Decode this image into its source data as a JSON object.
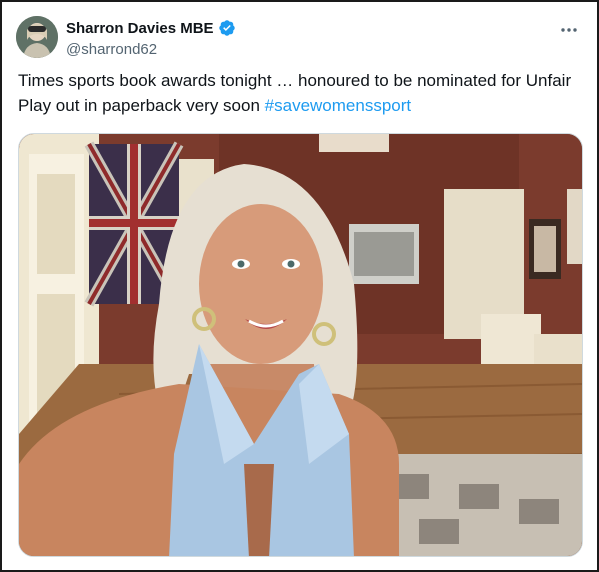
{
  "author": {
    "display_name": "Sharron Davies MBE",
    "handle": "@sharrond62",
    "avatar_icon": "user-avatar",
    "verified_icon": "verified-badge-icon",
    "verified_color": "#1d9bf0"
  },
  "menu": {
    "icon": "more-options-icon"
  },
  "tweet": {
    "text": "Times sports book awards tonight … honoured to be nominated for Unfair Play out in paperback very soon ",
    "hashtag": "#savewomenssport",
    "hashtag_color": "#1d9bf0"
  },
  "media": {
    "type": "photo"
  }
}
